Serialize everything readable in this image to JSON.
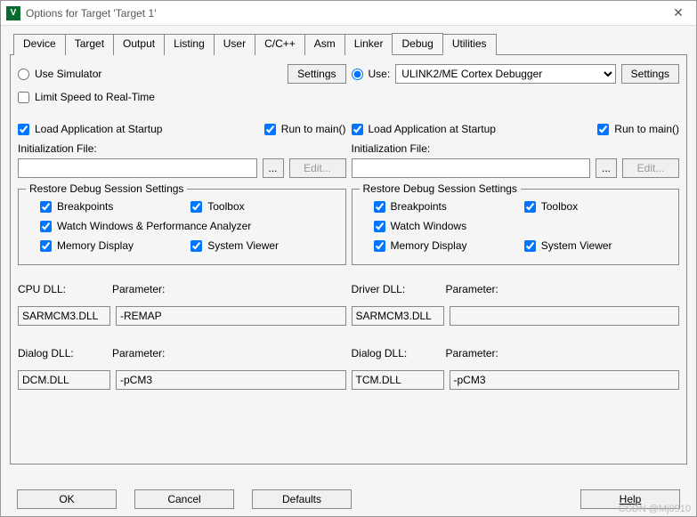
{
  "window": {
    "title": "Options for Target 'Target 1'"
  },
  "tabs": {
    "device": "Device",
    "target": "Target",
    "output": "Output",
    "listing": "Listing",
    "user": "User",
    "ccpp": "C/C++",
    "asm": "Asm",
    "linker": "Linker",
    "debug": "Debug",
    "utilities": "Utilities"
  },
  "left": {
    "use_simulator": "Use Simulator",
    "settings": "Settings",
    "limit_speed": "Limit Speed to Real-Time",
    "load_app": "Load Application at Startup",
    "run_to_main": "Run to main()",
    "init_file_label": "Initialization File:",
    "init_file_value": "",
    "browse": "...",
    "edit": "Edit...",
    "restore_group": "Restore Debug Session Settings",
    "breakpoints": "Breakpoints",
    "toolbox": "Toolbox",
    "watch": "Watch Windows & Performance Analyzer",
    "memory": "Memory Display",
    "system_viewer": "System Viewer",
    "cpu_dll_label": "CPU DLL:",
    "param_label": "Parameter:",
    "cpu_dll": "SARMCM3.DLL",
    "cpu_param": "-REMAP",
    "dialog_dll_label": "Dialog DLL:",
    "dialog_dll": "DCM.DLL",
    "dialog_param": "-pCM3"
  },
  "right": {
    "use_label": "Use:",
    "debugger": "ULINK2/ME Cortex Debugger",
    "settings": "Settings",
    "load_app": "Load Application at Startup",
    "run_to_main": "Run to main()",
    "init_file_label": "Initialization File:",
    "init_file_value": "",
    "browse": "...",
    "edit": "Edit...",
    "restore_group": "Restore Debug Session Settings",
    "breakpoints": "Breakpoints",
    "toolbox": "Toolbox",
    "watch": "Watch Windows",
    "memory": "Memory Display",
    "system_viewer": "System Viewer",
    "driver_dll_label": "Driver DLL:",
    "param_label": "Parameter:",
    "driver_dll": "SARMCM3.DLL",
    "driver_param": "",
    "dialog_dll_label": "Dialog DLL:",
    "dialog_dll": "TCM.DLL",
    "dialog_param": "-pCM3"
  },
  "footer": {
    "ok": "OK",
    "cancel": "Cancel",
    "defaults": "Defaults",
    "help": "Help"
  },
  "watermark": "CSDN @Mj0910"
}
